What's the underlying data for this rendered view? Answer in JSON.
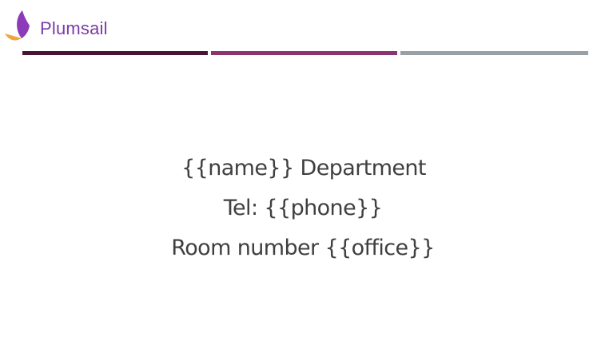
{
  "brand": {
    "name": "Plumsail",
    "text_color": "#7b3aa6",
    "icon": "plumsail-sail-logo",
    "icon_colors": {
      "upper_sail": "#8d3ab8",
      "lower_sail": "#f0a640"
    }
  },
  "divider": {
    "segments": [
      {
        "color": "#4a1436"
      },
      {
        "color": "#8c3470"
      },
      {
        "color": "#98a0a6"
      }
    ]
  },
  "body": {
    "line1": "{{name}} Department",
    "line2": "Tel: {{phone}}",
    "line3": "Room number {{office}}",
    "text_color": "#3f3f3f"
  }
}
